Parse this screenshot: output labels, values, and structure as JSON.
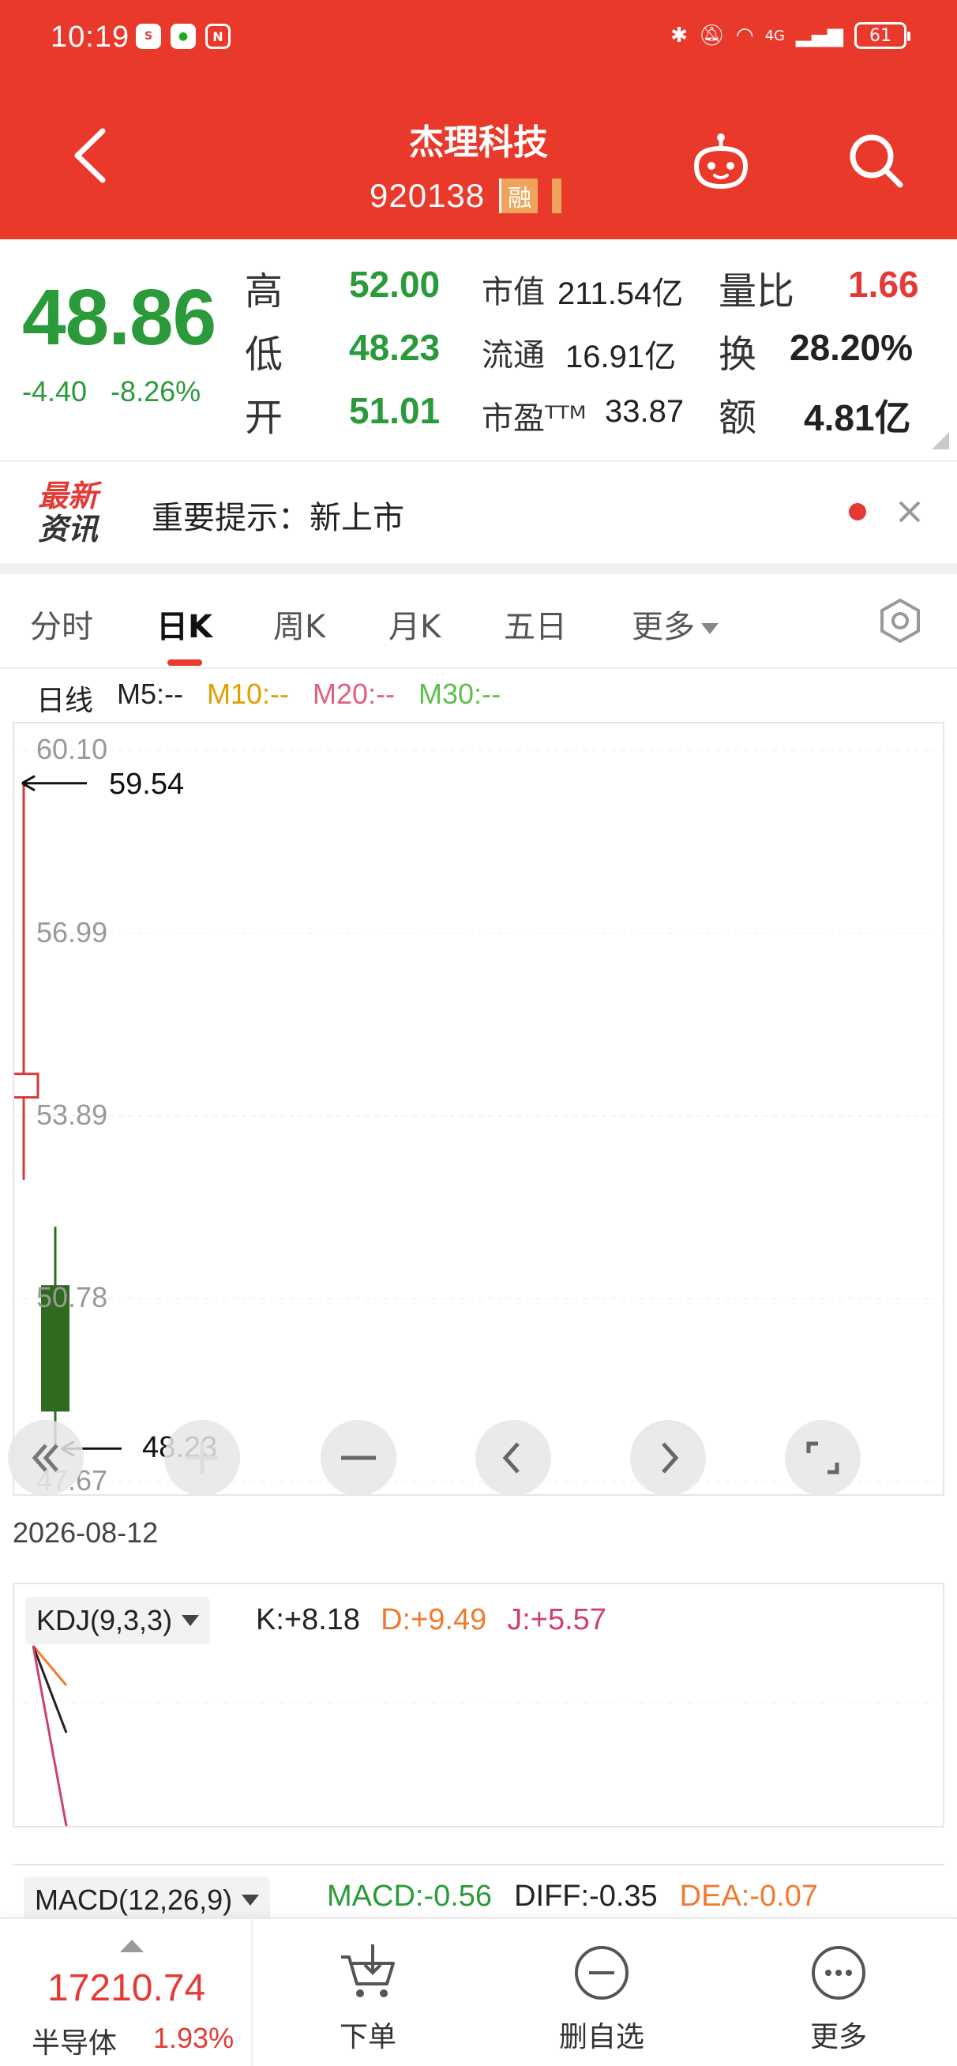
{
  "status_bar": {
    "time": "10:19",
    "apps": [
      "sina",
      "wechat",
      "nfc"
    ],
    "network": "4G",
    "battery": "61"
  },
  "header": {
    "stock_name": "杰理科技",
    "stock_code": "920138",
    "tag": "融",
    "icons": [
      "back-icon",
      "robot-icon",
      "search-icon"
    ]
  },
  "quote": {
    "price": "48.86",
    "change": "-4.40",
    "change_pct": "-8.26%",
    "high_label": "高",
    "high": "52.00",
    "low_label": "低",
    "low": "48.23",
    "open_label": "开",
    "open": "51.01",
    "mcap_label": "市值",
    "mcap": "211.54亿",
    "float_label": "流通",
    "float": "16.91亿",
    "pe_label": "市盈ᵀᵀᴹ",
    "pe": "33.87",
    "vol_ratio_label": "量比",
    "vol_ratio": "1.66",
    "turnover_label": "换",
    "turnover": "28.20%",
    "amount_label": "额",
    "amount": "4.81亿"
  },
  "news": {
    "logo_line1": "最新",
    "logo_line2": "资讯",
    "text": "重要提示：新上市"
  },
  "tabs": {
    "items": [
      "分时",
      "日K",
      "周K",
      "月K",
      "五日",
      "更多"
    ],
    "active": "日K"
  },
  "ma_legend": {
    "type": "日线",
    "ma5": "M5:--",
    "ma10": "M10:--",
    "ma20": "M20:--",
    "ma30": "M30:--"
  },
  "chart_data": {
    "type": "candlestick",
    "y_ticks": [
      "60.10",
      "56.99",
      "53.89",
      "50.78",
      "47.67"
    ],
    "ylim": [
      47.67,
      60.1
    ],
    "candles": [
      {
        "open": 54.2,
        "close": 54.6,
        "high": 59.54,
        "low": 52.8,
        "color": "red"
      },
      {
        "open": 51.01,
        "close": 48.86,
        "high": 52.0,
        "low": 48.23,
        "color": "green"
      }
    ],
    "high_annotation": "59.54",
    "low_annotation": "48.23",
    "date": "2026-08-12"
  },
  "zoom_controls": [
    "rewind-icon",
    "zoom-in-icon",
    "zoom-out-icon",
    "prev-icon",
    "next-icon",
    "fullscreen-icon"
  ],
  "kdj": {
    "name": "KDJ(9,3,3)",
    "k": "K:+8.18",
    "d": "D:+9.49",
    "j": "J:+5.57"
  },
  "macd": {
    "name": "MACD(12,26,9)",
    "macd": "MACD:-0.56",
    "diff": "DIFF:-0.35",
    "dea": "DEA:-0.07"
  },
  "bottom_bar": {
    "index_value": "17210.74",
    "index_name": "半导体",
    "index_pct": "1.93%",
    "order": "下单",
    "remove_watch": "删自选",
    "more": "更多"
  },
  "colors": {
    "header_red": "#e8392b",
    "up_red": "#e53935",
    "down_green": "#2a9a3a",
    "ma10": "#e0a000",
    "ma20": "#e0607e",
    "ma30": "#5fbf4f"
  }
}
